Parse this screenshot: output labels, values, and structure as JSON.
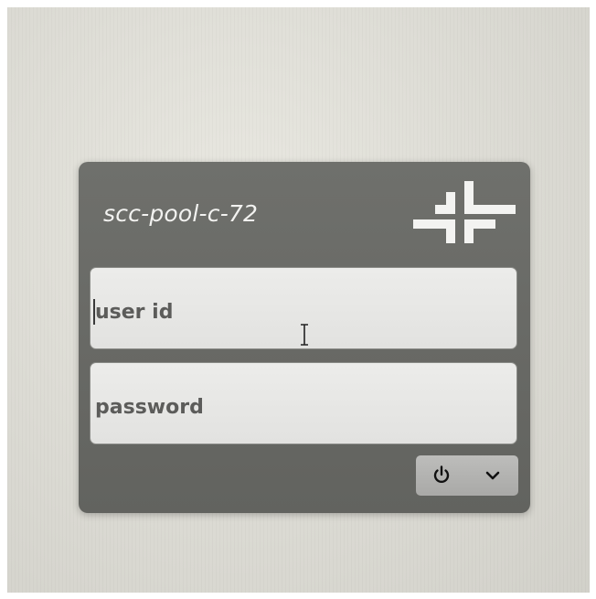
{
  "login": {
    "hostname": "scc-pool-c-72",
    "user_id_placeholder": "user id",
    "password_placeholder": "password"
  },
  "icons": {
    "logo": "cross-arrows-logo-icon",
    "power": "power-icon",
    "menu": "chevron-down-icon",
    "cursor": "text-cursor-icon"
  },
  "colors": {
    "panel": "#6a6b67",
    "field": "#e6e6e4",
    "text": "#5c5c5a",
    "hostname": "#f2f2f0"
  }
}
